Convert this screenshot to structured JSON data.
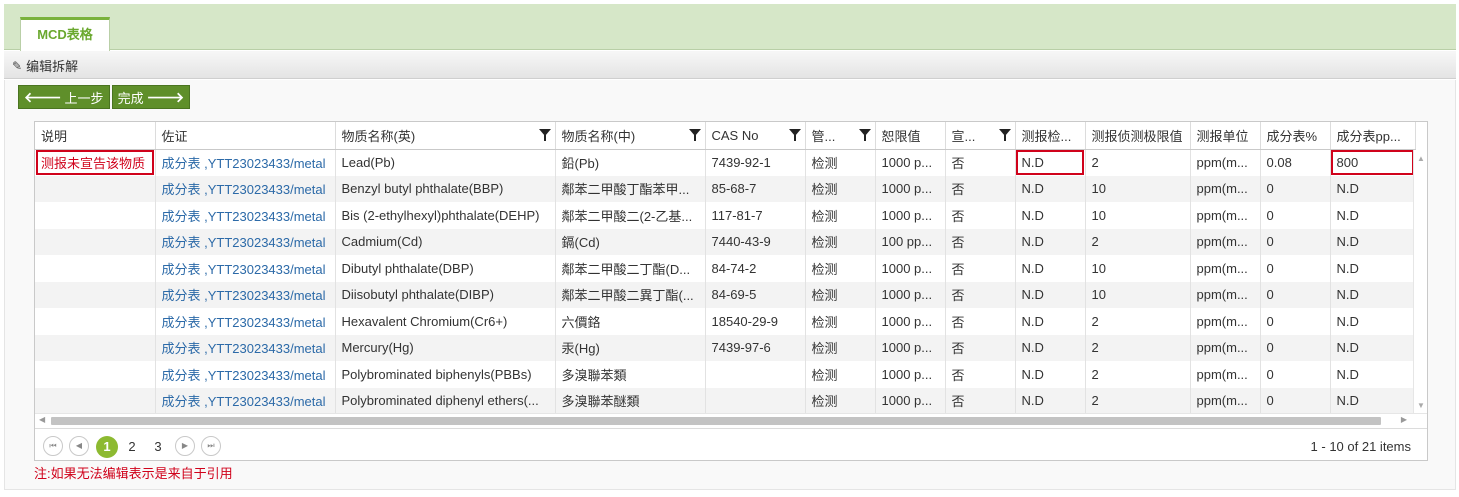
{
  "tab": {
    "label": "MCD表格"
  },
  "toolbar": {
    "edit_label": "编辑拆解"
  },
  "nav": {
    "prev_label": "上一步",
    "done_label": "完成"
  },
  "table": {
    "columns": [
      "说明",
      "佐证",
      "物质名称(英)",
      "物质名称(中)",
      "CAS No",
      "管...",
      "恕限值",
      "宣...",
      "测报检...",
      "测报侦测极限值",
      "测报单位",
      "成分表%",
      "成分表pp..."
    ],
    "rows": [
      [
        "测报未宣告该物质",
        "成分表 ,YTT23023433/metal",
        "Lead(Pb)",
        "鉛(Pb)",
        "7439-92-1",
        "检测",
        "1000 p...",
        "否",
        "N.D",
        "2",
        "ppm(m...",
        "0.08",
        "800"
      ],
      [
        "",
        "成分表 ,YTT23023433/metal",
        "Benzyl butyl phthalate(BBP)",
        "鄰苯二甲酸丁酯苯甲...",
        "85-68-7",
        "检测",
        "1000 p...",
        "否",
        "N.D",
        "10",
        "ppm(m...",
        "0",
        "N.D"
      ],
      [
        "",
        "成分表 ,YTT23023433/metal",
        "Bis (2-ethylhexyl)phthalate(DEHP)",
        "鄰苯二甲酸二(2-乙基...",
        "117-81-7",
        "检测",
        "1000 p...",
        "否",
        "N.D",
        "10",
        "ppm(m...",
        "0",
        "N.D"
      ],
      [
        "",
        "成分表 ,YTT23023433/metal",
        "Cadmium(Cd)",
        "鎘(Cd)",
        "7440-43-9",
        "检测",
        "100 pp...",
        "否",
        "N.D",
        "2",
        "ppm(m...",
        "0",
        "N.D"
      ],
      [
        "",
        "成分表 ,YTT23023433/metal",
        "Dibutyl phthalate(DBP)",
        "鄰苯二甲酸二丁酯(D...",
        "84-74-2",
        "检测",
        "1000 p...",
        "否",
        "N.D",
        "10",
        "ppm(m...",
        "0",
        "N.D"
      ],
      [
        "",
        "成分表 ,YTT23023433/metal",
        "Diisobutyl phthalate(DIBP)",
        "鄰苯二甲酸二異丁酯(...",
        "84-69-5",
        "检测",
        "1000 p...",
        "否",
        "N.D",
        "10",
        "ppm(m...",
        "0",
        "N.D"
      ],
      [
        "",
        "成分表 ,YTT23023433/metal",
        "Hexavalent Chromium(Cr6+)",
        "六價鉻",
        "18540-29-9",
        "检测",
        "1000 p...",
        "否",
        "N.D",
        "2",
        "ppm(m...",
        "0",
        "N.D"
      ],
      [
        "",
        "成分表 ,YTT23023433/metal",
        "Mercury(Hg)",
        "汞(Hg)",
        "7439-97-6",
        "检测",
        "1000 p...",
        "否",
        "N.D",
        "2",
        "ppm(m...",
        "0",
        "N.D"
      ],
      [
        "",
        "成分表 ,YTT23023433/metal",
        "Polybrominated biphenyls(PBBs)",
        "多溴聯苯類",
        "",
        "检测",
        "1000 p...",
        "否",
        "N.D",
        "2",
        "ppm(m...",
        "0",
        "N.D"
      ],
      [
        "",
        "成分表 ,YTT23023433/metal",
        "Polybrominated diphenyl ethers(...",
        "多溴聯苯醚類",
        "",
        "检测",
        "1000 p...",
        "否",
        "N.D",
        "2",
        "ppm(m...",
        "0",
        "N.D"
      ]
    ]
  },
  "pager": {
    "pages": [
      "1",
      "2",
      "3"
    ],
    "current": "1",
    "info": "1 - 10 of 21 items"
  },
  "footnote": "注:如果无法编辑表示是来自于引用",
  "colors": {
    "accent": "#8dba31",
    "button": "#5f8f2a",
    "alert": "#d0021b",
    "link": "#2c6aa8"
  }
}
